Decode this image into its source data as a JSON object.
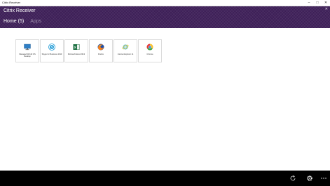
{
  "window": {
    "title": "Citrix Receiver"
  },
  "header": {
    "app_title": "Citrix Receiver"
  },
  "tabs": [
    {
      "label": "Home (5)",
      "active": true
    },
    {
      "label": "Apps",
      "active": false
    }
  ],
  "apps": [
    {
      "label": "Managed Win10 OS Desktop",
      "icon": "monitor-icon"
    },
    {
      "label": "Skype for Business 2013",
      "icon": "skype-icon"
    },
    {
      "label": "Microsoft Excel 2013",
      "icon": "excel-icon"
    },
    {
      "label": "Firefox",
      "icon": "firefox-icon"
    },
    {
      "label": "Internet Explorer 11",
      "icon": "internet-explorer-icon"
    },
    {
      "label": "Chrome",
      "icon": "chrome-icon"
    }
  ],
  "bottom_bar": {
    "buttons": [
      "refresh-icon",
      "settings-icon",
      "more-icon"
    ]
  },
  "colors": {
    "header": "#3d1f57",
    "bottom_bar": "#000000"
  }
}
